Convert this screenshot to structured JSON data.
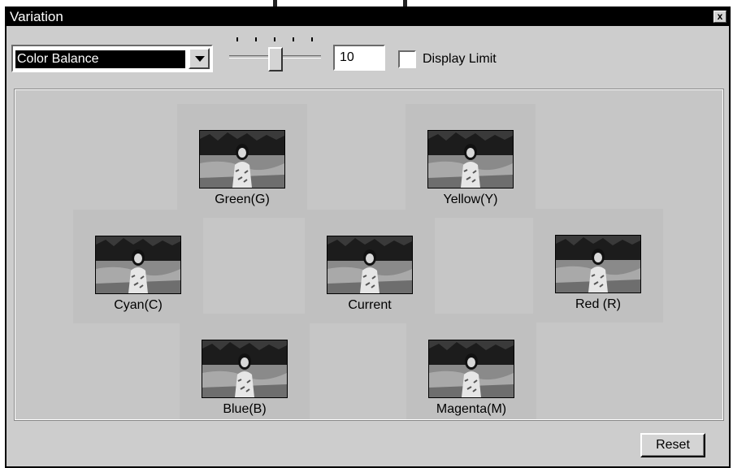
{
  "window": {
    "title": "Variation",
    "close_label": "x"
  },
  "toolbar": {
    "mode_select": {
      "value": "Color Balance"
    },
    "amount_slider": {
      "value": 10,
      "min": 0,
      "max": 20
    },
    "amount_input": {
      "value": "10"
    },
    "display_limit": {
      "label": "Display Limit",
      "checked": false
    }
  },
  "variations": [
    {
      "id": "green",
      "label": "Green(G)"
    },
    {
      "id": "yellow",
      "label": "Yellow(Y)"
    },
    {
      "id": "cyan",
      "label": "Cyan(C)"
    },
    {
      "id": "current",
      "label": "Current"
    },
    {
      "id": "red",
      "label": "Red (R)"
    },
    {
      "id": "blue",
      "label": "Blue(B)"
    },
    {
      "id": "magenta",
      "label": "Magenta(M)"
    }
  ],
  "footer": {
    "reset_label": "Reset"
  }
}
